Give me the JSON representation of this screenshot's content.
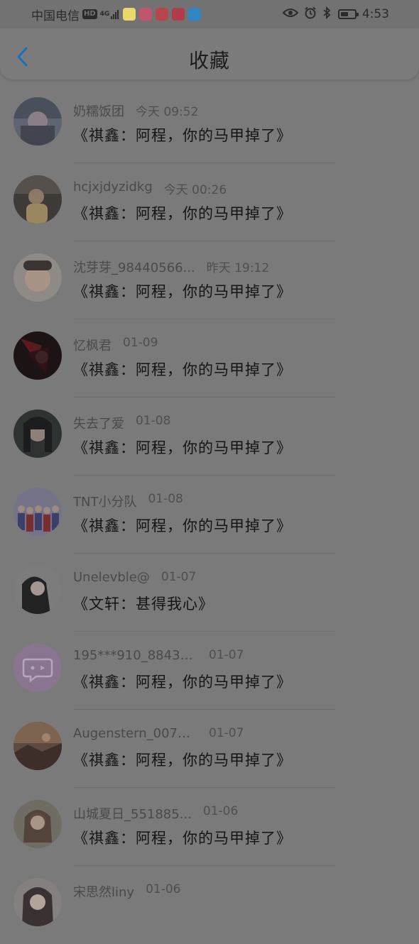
{
  "status_bar": {
    "carrier": "中国电信",
    "hd": "HD",
    "network": "4G",
    "time": "4:53",
    "battery_level": 0.55
  },
  "header": {
    "title": "收藏",
    "back_icon": "chevron-left-icon",
    "accent": "#1e6fb5"
  },
  "items": [
    {
      "name": "奶糯饭团",
      "time": "今天 09:52",
      "message": "《祺鑫：阿程，你的马甲掉了》"
    },
    {
      "name": "hcjxjdyzidkg",
      "time": "今天 00:26",
      "message": "《祺鑫：阿程，你的马甲掉了》"
    },
    {
      "name": "沈芽芽_98440566...",
      "time": "昨天 19:12",
      "message": "《祺鑫：阿程，你的马甲掉了》"
    },
    {
      "name": "忆枫君",
      "time": "01-09",
      "message": "《祺鑫：阿程，你的马甲掉了》"
    },
    {
      "name": "失去了爱",
      "time": "01-08",
      "message": "《祺鑫：阿程，你的马甲掉了》"
    },
    {
      "name": "TNT小分队",
      "time": "01-08",
      "message": "《祺鑫：阿程，你的马甲掉了》"
    },
    {
      "name": "Unelevble@",
      "time": "01-07",
      "message": "《文轩：甚得我心》"
    },
    {
      "name": "195***910_88430...",
      "time": "01-07",
      "message": "《祺鑫：阿程，你的马甲掉了》"
    },
    {
      "name": "Augenstern_0072...",
      "time": "01-07",
      "message": "《祺鑫：阿程，你的马甲掉了》"
    },
    {
      "name": "山城夏日_551885...",
      "time": "01-06",
      "message": "《祺鑫：阿程，你的马甲掉了》"
    },
    {
      "name": "宋思然liny",
      "time": "01-06",
      "message": ""
    }
  ]
}
